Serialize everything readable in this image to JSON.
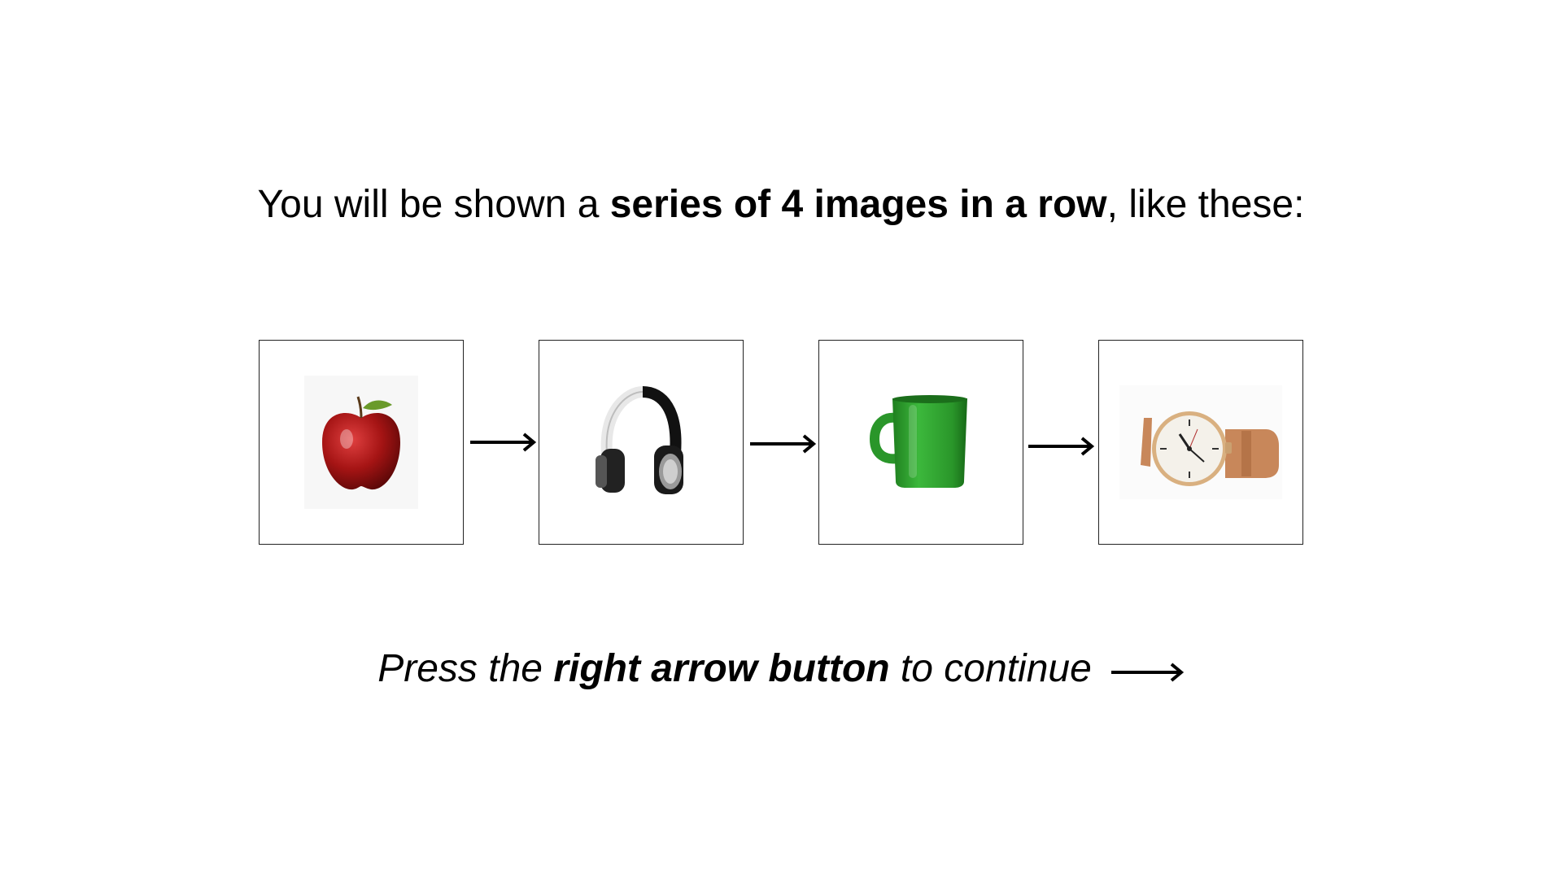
{
  "headline": {
    "prefix": "You will be shown a ",
    "emphasis": "series of 4 images in a row",
    "suffix": ", like these:"
  },
  "images": [
    {
      "icon": "apple-icon",
      "alt": "apple",
      "color": "#b01818"
    },
    {
      "icon": "headphones-icon",
      "alt": "headphones",
      "color": "#1a1a1a"
    },
    {
      "icon": "mug-icon",
      "alt": "mug",
      "color": "#2e9e2e"
    },
    {
      "icon": "watch-icon",
      "alt": "watch",
      "color": "#c8875a"
    }
  ],
  "sequence_arrow_icon": "right-arrow-icon",
  "footer": {
    "prefix": "Press the ",
    "emphasis": "right arrow button",
    "suffix": " to continue",
    "arrow_icon": "right-arrow-icon"
  }
}
